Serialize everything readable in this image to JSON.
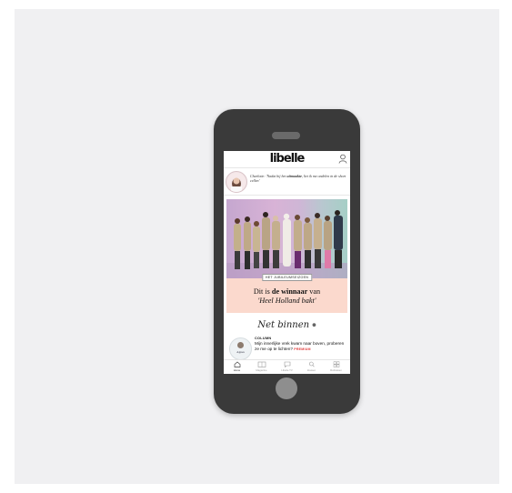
{
  "app": {
    "logo": "libelle"
  },
  "quote": {
    "text_prefix": "Charlotte: 'Nadat hij het ",
    "text_bold": "uitmaakte",
    "text_suffix": ", liet ik me ondelen in de short cellen'"
  },
  "hero": {
    "label": "HET JUBILEUMSEIZOEN",
    "headline_pre": "Dit is ",
    "headline_bold": "de winnaar",
    "headline_mid": " van",
    "headline_italic": "'Heel Holland bakt'"
  },
  "section": {
    "title": "Net binnen",
    "dot": "●"
  },
  "article": {
    "thumb_name": "Agnes",
    "kicker": "COLUMN",
    "title": "Mijn innerlijke vrek kwam naar boven, proberen ze me op te lichten?",
    "tag": "PREMIUM"
  },
  "tabs": [
    {
      "label": "Home",
      "icon": "home-icon"
    },
    {
      "label": "Magazine",
      "icon": "magazine-icon"
    },
    {
      "label": "Libelle TV",
      "icon": "chat-icon"
    },
    {
      "label": "Zoeken",
      "icon": "search-icon"
    },
    {
      "label": "Rubrieken",
      "icon": "grid-icon"
    }
  ],
  "colors": {
    "phone_body": "#3a3a3a",
    "hero_card": "#fbd9cd",
    "premium_tag": "#e03c3c"
  }
}
